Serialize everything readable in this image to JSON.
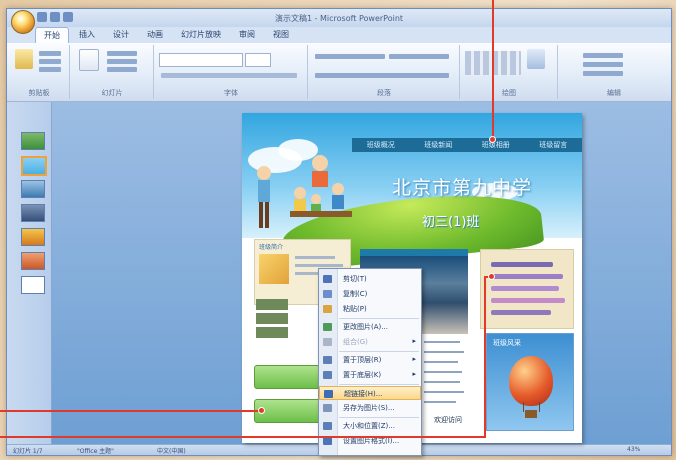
{
  "window": {
    "title": "演示文稿1 - Microsoft PowerPoint",
    "tabs": [
      "开始",
      "插入",
      "设计",
      "动画",
      "幻灯片放映",
      "审阅",
      "视图"
    ],
    "active_tab": "开始",
    "ribbon_groups": [
      "剪贴板",
      "幻灯片",
      "字体",
      "段落",
      "绘图",
      "编辑"
    ]
  },
  "slide": {
    "nav_items": [
      "班级概况",
      "班级新闻",
      "班级相册",
      "班级留言"
    ],
    "school_name": "北京市第九中学",
    "class_name": "初三(1)班",
    "left_box_header": "班级简介",
    "photo_caption": "",
    "balloon_title": "班级风采",
    "footer_text": "欢迎访问"
  },
  "context_menu": {
    "items": [
      {
        "label": "剪切(T)",
        "state": "normal",
        "icon": "scissors-icon",
        "color": "#4a73b8"
      },
      {
        "label": "复制(C)",
        "state": "normal",
        "icon": "copy-icon",
        "color": "#6c8fc9"
      },
      {
        "label": "粘贴(P)",
        "state": "normal",
        "icon": "paste-icon",
        "color": "#d9a442"
      },
      {
        "label": "更改图片(A)...",
        "state": "normal",
        "icon": "picture-icon",
        "color": "#4f9a56"
      },
      {
        "label": "组合(G)",
        "state": "disabled",
        "icon": "group-icon",
        "color": "#aab5c6"
      },
      {
        "label": "置于顶层(R)",
        "state": "normal",
        "icon": "bring-front-icon",
        "color": "#5d7fb8"
      },
      {
        "label": "置于底层(K)",
        "state": "normal",
        "icon": "send-back-icon",
        "color": "#5d7fb8"
      },
      {
        "label": "超链接(H)...",
        "state": "highlighted",
        "icon": "hyperlink-icon",
        "color": "#3f6db5"
      },
      {
        "label": "另存为图片(S)...",
        "state": "normal",
        "icon": "save-picture-icon",
        "color": "#7f95b9"
      },
      {
        "label": "大小和位置(Z)...",
        "state": "normal",
        "icon": "size-position-icon",
        "color": "#5d7fb8"
      },
      {
        "label": "设置图片格式(I)...",
        "state": "normal",
        "icon": "format-picture-icon",
        "color": "#4a73b8"
      }
    ]
  },
  "status_bar": {
    "slide_info": "幻灯片 1/7",
    "theme": "\"Office 主题\"",
    "language": "中文(中国)",
    "zoom": "43%"
  },
  "colors": {
    "annotation": "#e23a2a",
    "sky": "#32a6e0",
    "nav": "#1d6c98"
  }
}
